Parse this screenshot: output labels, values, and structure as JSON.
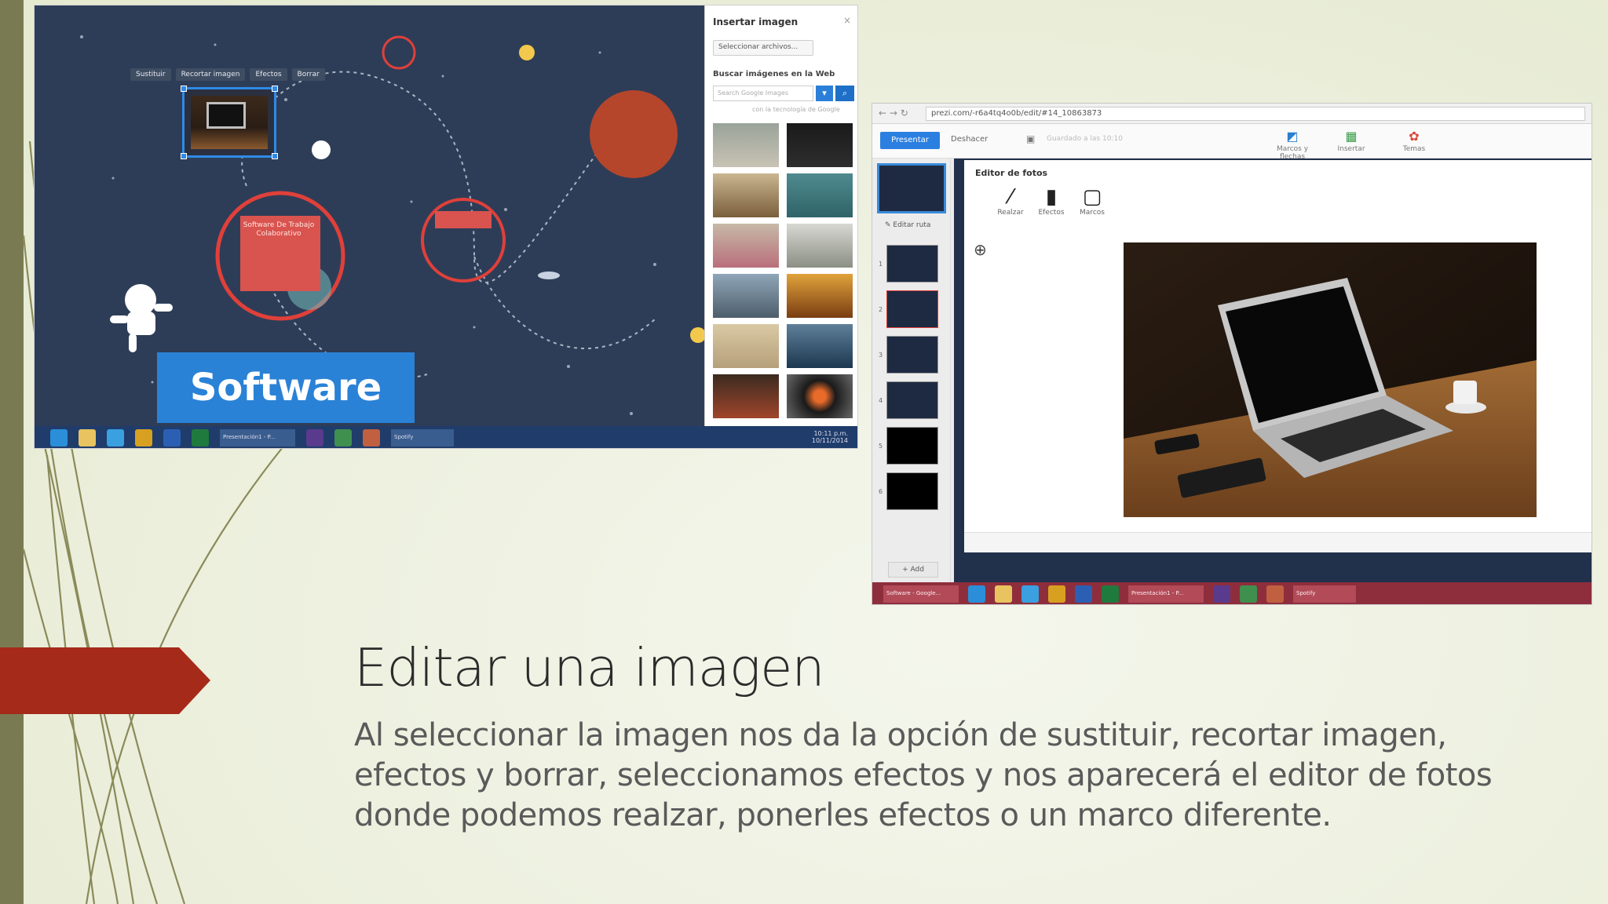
{
  "slide": {
    "title": "Editar una imagen",
    "body": "Al seleccionar la imagen nos da la opción de sustituir, recortar imagen, efectos y borrar, seleccionamos efectos y nos aparecerá el editor de fotos donde podemos realzar, ponerles efectos o un marco diferente.",
    "accent_color": "#a52a1a",
    "sidebar_color": "#7a7a52"
  },
  "screenshot1": {
    "image_toolbar": [
      "Sustituir",
      "Recortar imagen",
      "Efectos",
      "Borrar"
    ],
    "circle_title": "Software De Trabajo Colaborativo",
    "banner": "Software",
    "insert_panel": {
      "title": "Insertar imagen",
      "close": "×",
      "select_files": "Seleccionar archivos...",
      "web_search": "Buscar imágenes en la Web",
      "search_placeholder": "Search Google Images",
      "google_note": "con la tecnología de Google"
    },
    "taskbar": {
      "window_label": "Presentación1 - P...",
      "spotify_label": "Spotify",
      "clock_time": "10:11 p.m.",
      "clock_date": "10/11/2014"
    }
  },
  "screenshot2": {
    "url": "prezi.com/-r6a4tq4o0b/edit/#14_10863873",
    "present_button": "Presentar",
    "undo": "Deshacer",
    "saved_text": "Guardado a las 10:10",
    "top_buttons": [
      "Marcos y flechas",
      "Insertar",
      "Temas"
    ],
    "edit_path": "Editar ruta",
    "add_button": "Add",
    "slide_numbers": [
      "1",
      "2",
      "3",
      "4",
      "5",
      "6"
    ],
    "editor": {
      "title": "Editor de fotos",
      "tools": [
        "Realzar",
        "Efectos",
        "Marcos"
      ]
    },
    "taskbar": {
      "chrome_label": "Software - Google...",
      "ppt_label": "Presentación1 - P...",
      "spotify_label": "Spotify"
    }
  }
}
